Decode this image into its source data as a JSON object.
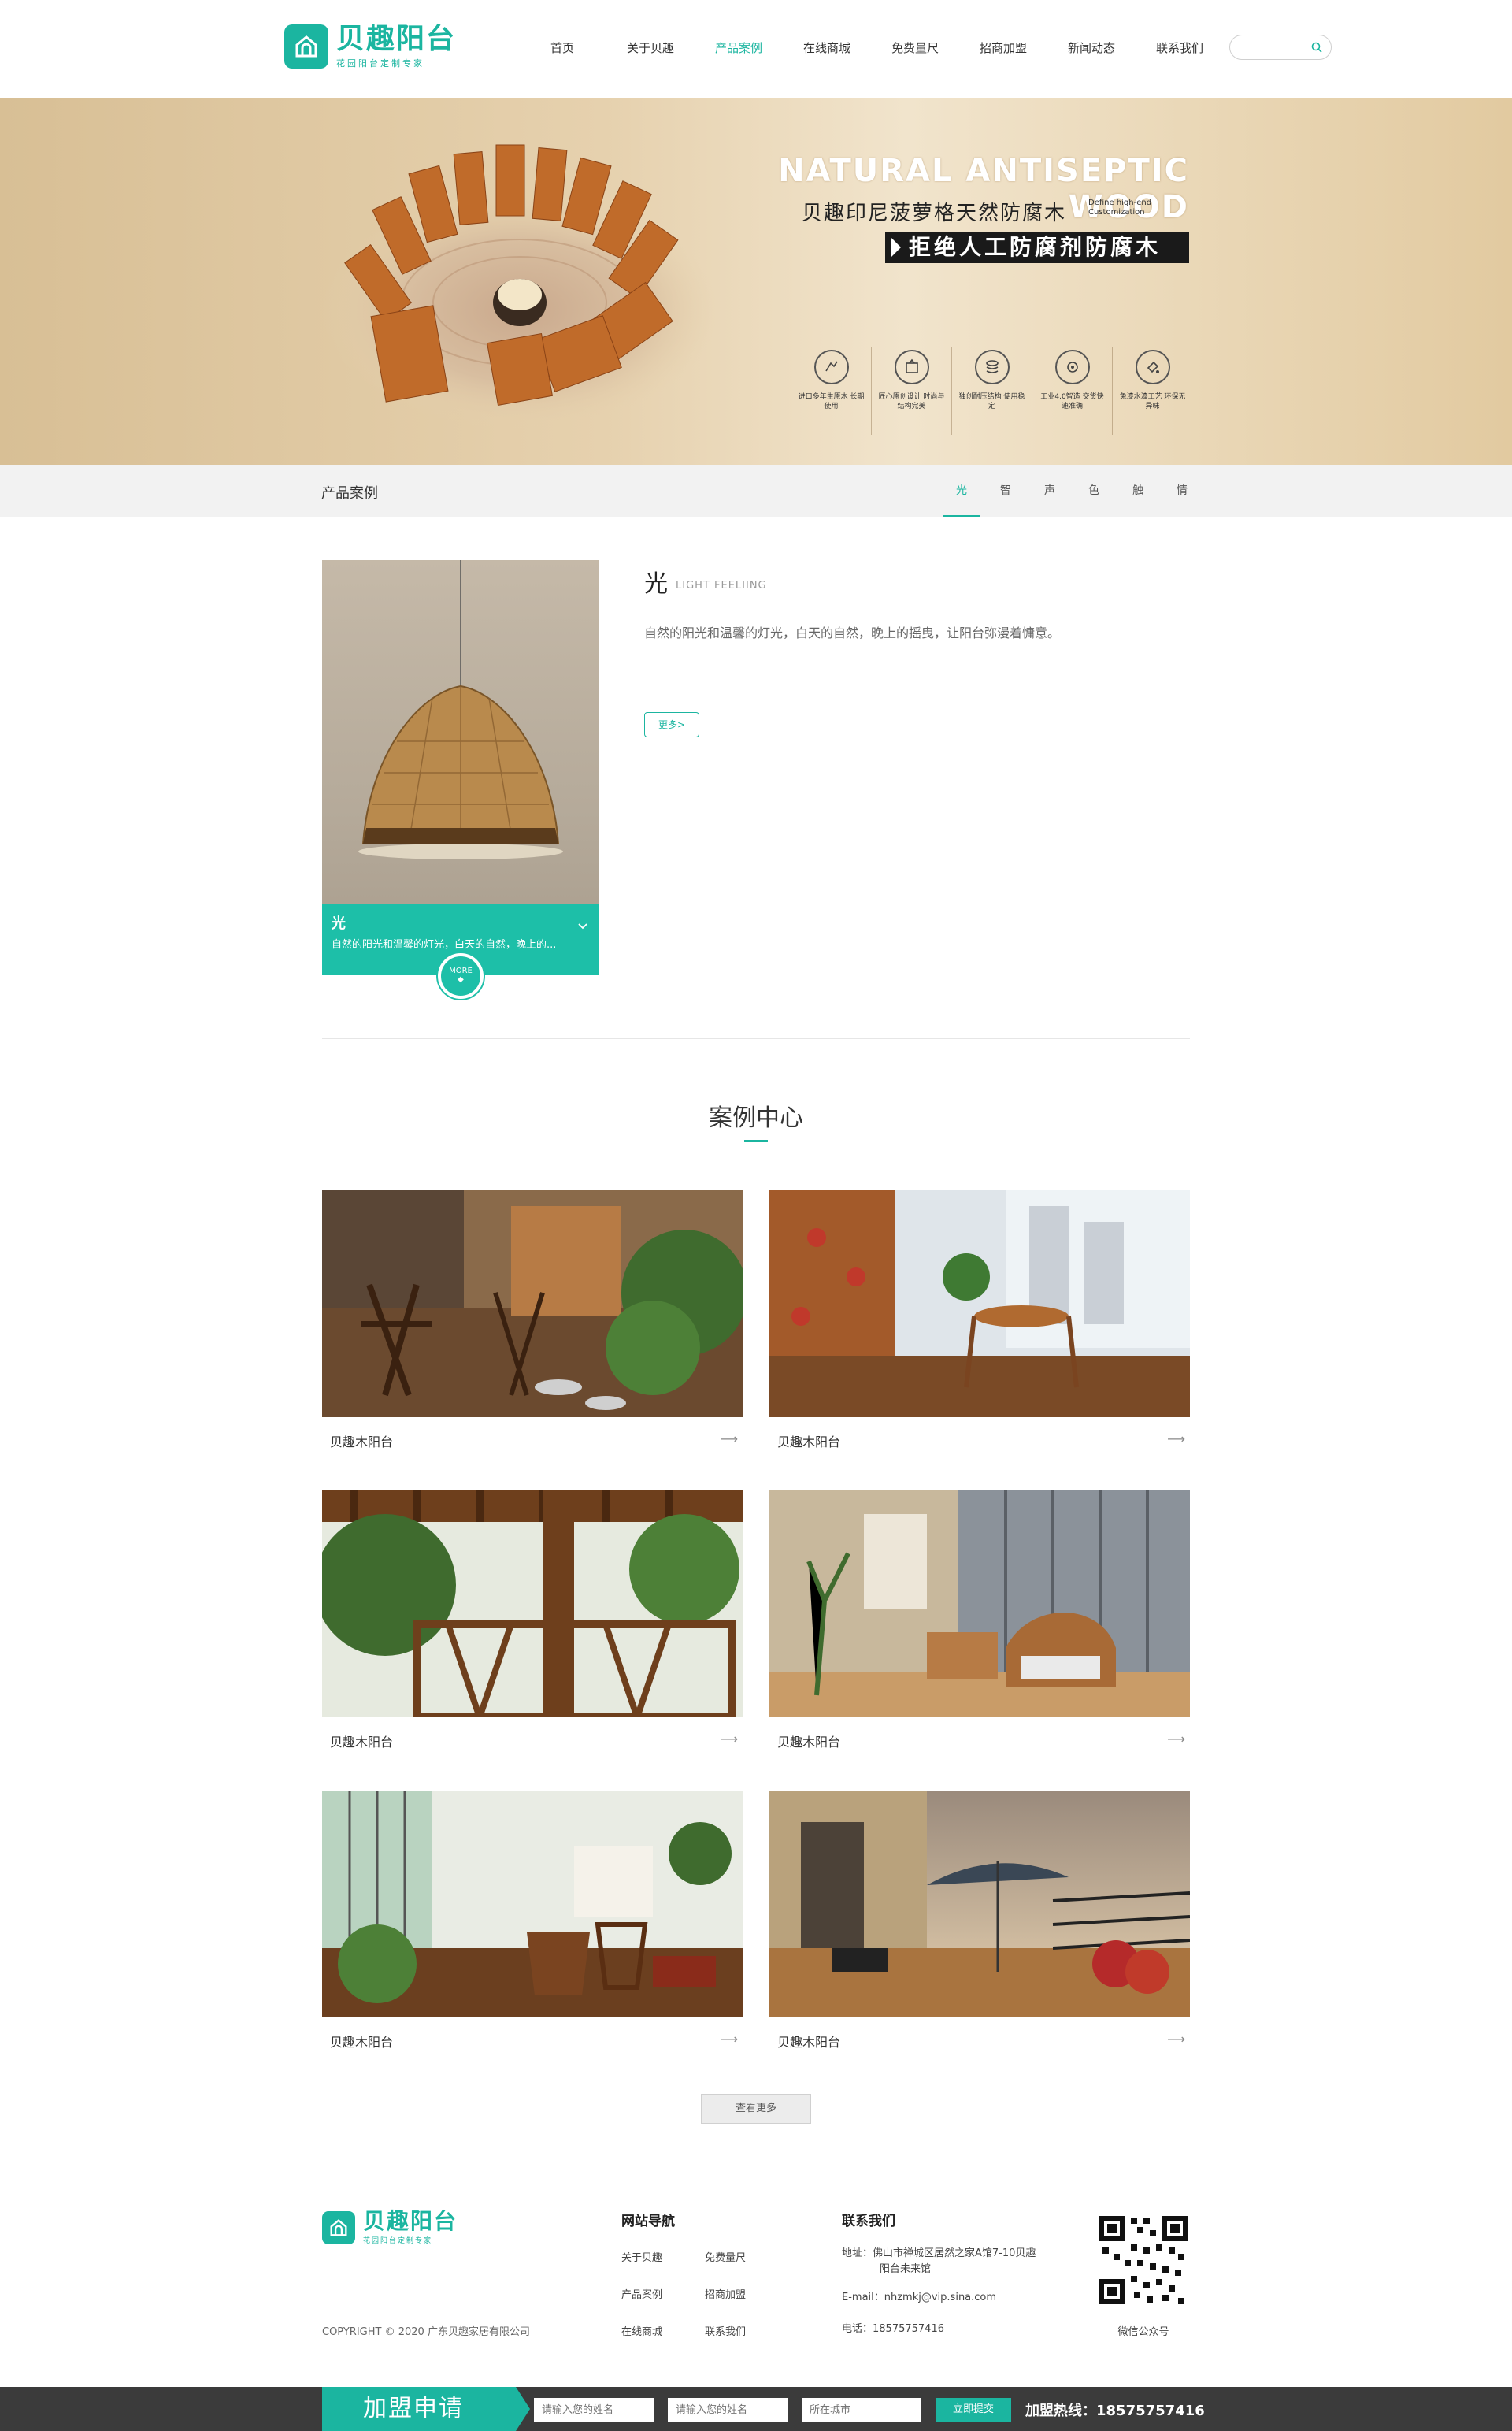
{
  "brand": {
    "name": "贝趣阳台",
    "tagline": "花园阳台定制专家"
  },
  "nav": {
    "items": [
      "首页",
      "关于贝趣",
      "产品案例",
      "在线商城",
      "免费量尺",
      "招商加盟",
      "新闻动态",
      "联系我们"
    ],
    "active_index": 2
  },
  "search": {
    "placeholder": ""
  },
  "banner": {
    "title_en": "NATURAL ANTISEPTIC WOOD",
    "subtitle": "贝趣印尼菠萝格天然防腐木",
    "define": "Define high-end Customization",
    "tag": "拒绝人工防腐剂防腐木",
    "features": [
      {
        "icon": "hand-wood-icon",
        "text": "进口多年生原木 长期使用"
      },
      {
        "icon": "design-icon",
        "text": "匠心原创设计 时尚与结构完美"
      },
      {
        "icon": "layers-icon",
        "text": "独创耐压结构 使用稳定"
      },
      {
        "icon": "gear-icon",
        "text": "工业4.0智造 交货快速准确"
      },
      {
        "icon": "paint-icon",
        "text": "免漆水漆工艺 环保无异味"
      }
    ]
  },
  "subnav": {
    "title": "产品案例",
    "tabs": [
      "光",
      "智",
      "声",
      "色",
      "触",
      "情"
    ],
    "active_index": 0
  },
  "product": {
    "title": "光",
    "title_en": "LIGHT FEELIING",
    "description": "自然的阳光和温馨的灯光，白天的自然，晚上的摇曳，让阳台弥漫着慵意。",
    "more_label": "更多>",
    "caption_title": "光",
    "caption_desc": "自然的阳光和温馨的灯光，白天的自然，晚上的...",
    "more_circle_label": "MORE"
  },
  "cases": {
    "title": "案例中心",
    "items": [
      {
        "label": "贝趣木阳台",
        "arrow": "⟶"
      },
      {
        "label": "贝趣木阳台",
        "arrow": "⟶"
      },
      {
        "label": "贝趣木阳台",
        "arrow": "⟶"
      },
      {
        "label": "贝趣木阳台",
        "arrow": "⟶"
      },
      {
        "label": "贝趣木阳台",
        "arrow": "⟶"
      },
      {
        "label": "贝趣木阳台",
        "arrow": "⟶"
      }
    ],
    "view_more": "查看更多"
  },
  "footer": {
    "copyright": "COPYRIGHT © 2020 广东贝趣家居有限公司",
    "nav_title": "网站导航",
    "nav_links": [
      "关于贝趣",
      "免费量尺",
      "产品案例",
      "招商加盟",
      "在线商城",
      "联系我们"
    ],
    "contact_title": "联系我们",
    "address_line1": "地址：佛山市禅城区居然之家A馆7-10贝趣",
    "address_line2": "阳台未来馆",
    "email": "E-mail：nhzmkj@vip.sina.com",
    "phone": "电话：18575757416",
    "qr_label": "微信公众号"
  },
  "join_bar": {
    "title": "加盟申请",
    "name_placeholder": "请输入您的姓名",
    "phone_placeholder": "请输入您的姓名",
    "city_placeholder": "所在城市",
    "submit": "立即提交",
    "hotline": "加盟热线：18575757416"
  },
  "colors": {
    "accent": "#1bb5a0",
    "banner": "#e2caa0",
    "bar": "#3b3b3b"
  }
}
